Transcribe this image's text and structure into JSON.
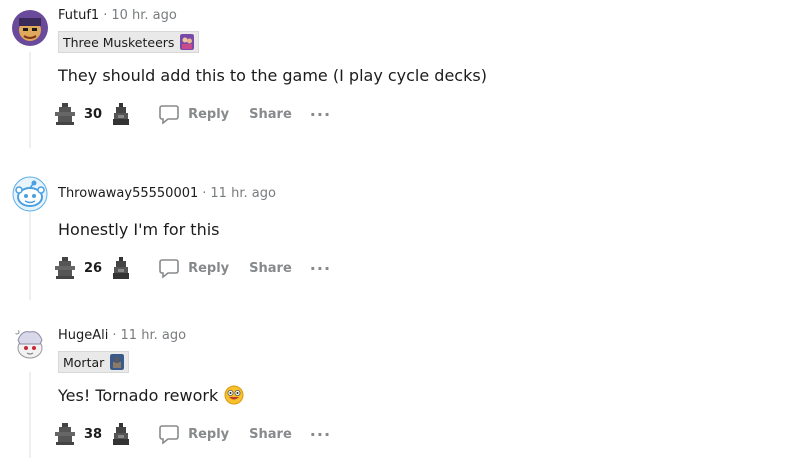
{
  "comments": [
    {
      "author": "Futuf1",
      "time": "10 hr. ago",
      "flair": "Three Musketeers",
      "body": "They should add this to the game (I play cycle decks)",
      "score": "30"
    },
    {
      "author": "Throwaway55550001",
      "time": "11 hr. ago",
      "flair": "",
      "body": "Honestly I'm for this",
      "score": "26"
    },
    {
      "author": "HugeAli",
      "time": "11 hr. ago",
      "flair": "Mortar",
      "body": "Yes! Tornado rework",
      "score": "38"
    }
  ],
  "actions": {
    "reply": "Reply",
    "share": "Share",
    "more": "···",
    "separator": "·"
  },
  "colors": {
    "muted": "#787c7e",
    "action": "#878a8c",
    "flair_bg": "#e9e9e9",
    "thread_line": "#edeff1"
  }
}
